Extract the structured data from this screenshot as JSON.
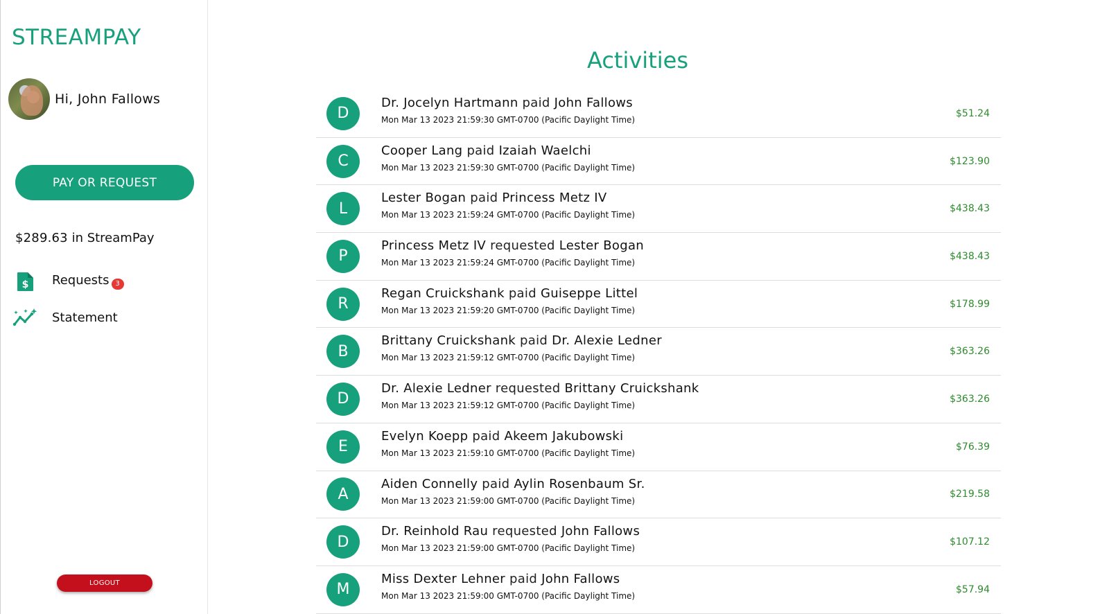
{
  "app": {
    "brand": "STREAMPAY",
    "greeting": "Hi, John Fallows",
    "pay_button": "PAY OR REQUEST",
    "balance_amount": "$289.63",
    "balance_suffix": " in StreamPay",
    "logout": "LOGOUT",
    "accent_color": "#17a07c"
  },
  "nav": {
    "requests": {
      "label": "Requests",
      "badge": "3",
      "icon": "dollar-document-icon"
    },
    "statement": {
      "label": "Statement",
      "icon": "sparkle-trend-icon"
    }
  },
  "main": {
    "title": "Activities",
    "activities": [
      {
        "initial": "D",
        "from": "Dr. Jocelyn Hartmann",
        "verb": " paid ",
        "to": "John Fallows",
        "time": "Mon Mar 13 2023 21:59:30 GMT-0700 (Pacific Daylight Time)",
        "amount": "$51.24"
      },
      {
        "initial": "C",
        "from": "Cooper Lang",
        "verb": " paid ",
        "to": "Izaiah Waelchi",
        "time": "Mon Mar 13 2023 21:59:30 GMT-0700 (Pacific Daylight Time)",
        "amount": "$123.90"
      },
      {
        "initial": "L",
        "from": "Lester Bogan",
        "verb": " paid ",
        "to": "Princess Metz IV",
        "time": "Mon Mar 13 2023 21:59:24 GMT-0700 (Pacific Daylight Time)",
        "amount": "$438.43"
      },
      {
        "initial": "P",
        "from": "Princess Metz IV",
        "verb": " requested ",
        "to": "Lester Bogan",
        "time": "Mon Mar 13 2023 21:59:24 GMT-0700 (Pacific Daylight Time)",
        "amount": "$438.43"
      },
      {
        "initial": "R",
        "from": "Regan Cruickshank",
        "verb": " paid ",
        "to": "Guiseppe Littel",
        "time": "Mon Mar 13 2023 21:59:20 GMT-0700 (Pacific Daylight Time)",
        "amount": "$178.99"
      },
      {
        "initial": "B",
        "from": "Brittany Cruickshank",
        "verb": " paid ",
        "to": "Dr. Alexie Ledner",
        "time": "Mon Mar 13 2023 21:59:12 GMT-0700 (Pacific Daylight Time)",
        "amount": "$363.26"
      },
      {
        "initial": "D",
        "from": "Dr. Alexie Ledner",
        "verb": " requested ",
        "to": "Brittany Cruickshank",
        "time": "Mon Mar 13 2023 21:59:12 GMT-0700 (Pacific Daylight Time)",
        "amount": "$363.26"
      },
      {
        "initial": "E",
        "from": "Evelyn Koepp",
        "verb": " paid ",
        "to": "Akeem Jakubowski",
        "time": "Mon Mar 13 2023 21:59:10 GMT-0700 (Pacific Daylight Time)",
        "amount": "$76.39"
      },
      {
        "initial": "A",
        "from": "Aiden Connelly",
        "verb": " paid ",
        "to": "Aylin Rosenbaum Sr.",
        "time": "Mon Mar 13 2023 21:59:00 GMT-0700 (Pacific Daylight Time)",
        "amount": "$219.58"
      },
      {
        "initial": "D",
        "from": "Dr. Reinhold Rau",
        "verb": " requested ",
        "to": "John Fallows",
        "time": "Mon Mar 13 2023 21:59:00 GMT-0700 (Pacific Daylight Time)",
        "amount": "$107.12"
      },
      {
        "initial": "M",
        "from": "Miss Dexter Lehner",
        "verb": " paid ",
        "to": "John Fallows",
        "time": "Mon Mar 13 2023 21:59:00 GMT-0700 (Pacific Daylight Time)",
        "amount": "$57.94"
      }
    ]
  }
}
